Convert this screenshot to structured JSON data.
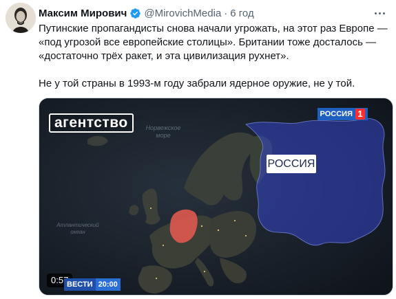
{
  "author": {
    "name": "Максим Мирович",
    "handle": "@MirovichMedia",
    "separator": "·",
    "time": "6 год",
    "verified": true
  },
  "tweet": {
    "lines_p1": [
      "Путинские пропагандисты снова начали угрожать, на этот раз Европе —",
      "«под угрозой все европейские столицы». Британии тоже досталось —",
      "«достаточно трёх ракет, и эта цивилизация рухнет»."
    ],
    "line_p2": "Не у той страны в 1993-м году забрали ядерное оружие, не у той."
  },
  "media": {
    "duration": "0:57",
    "agency_logo": "агентство",
    "channel_logo": "РОССИЯ",
    "channel_number": "1",
    "map_label": "РОССИЯ",
    "sea_north": "Норвежское море",
    "sea_atlantic": "Атлантический океан",
    "ticker_brand": "ВЕСТИ",
    "ticker_time": "20:00"
  },
  "colors": {
    "accent_blue": "#1d9bf0",
    "russia_highlight": "#3b4fd8",
    "germany_highlight": "#e0524a"
  },
  "icons": {
    "verified": "verified-badge-icon",
    "more": "more-options-icon"
  }
}
